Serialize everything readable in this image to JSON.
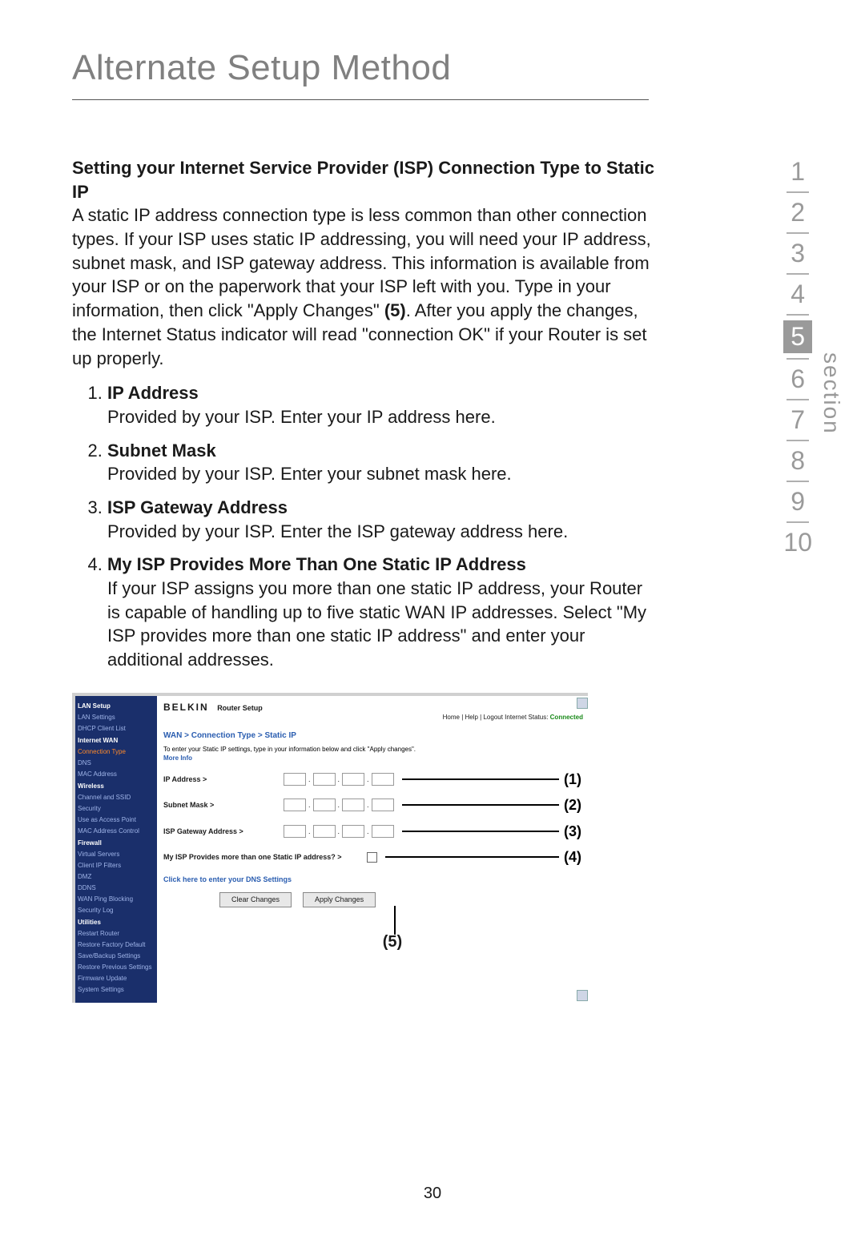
{
  "page_number": "30",
  "title": "Alternate Setup Method",
  "section_label": "section",
  "nav": {
    "items": [
      "1",
      "2",
      "3",
      "4",
      "5",
      "6",
      "7",
      "8",
      "9",
      "10"
    ],
    "current": "5"
  },
  "intro": {
    "heading": "Setting your Internet Service Provider (ISP) Connection Type to Static IP",
    "body_a": "A static IP address connection type is less common than other connection types. If your ISP uses static IP addressing, you will need your IP address, subnet mask, and ISP gateway address. This information is available from your ISP or on the paperwork that your ISP left with you. Type in your information, then click \"Apply Changes\" ",
    "body_bold": "(5)",
    "body_b": ". After you apply the changes, the Internet Status indicator will read \"connection OK\" if your Router is set up properly."
  },
  "fields": [
    {
      "h": "IP Address",
      "d": "Provided by your ISP. Enter your IP address here."
    },
    {
      "h": "Subnet Mask",
      "d": "Provided by your ISP. Enter your subnet mask here."
    },
    {
      "h": "ISP Gateway Address",
      "d": "Provided by your ISP. Enter the ISP gateway address here."
    },
    {
      "h": "My ISP Provides More Than One Static IP Address",
      "d": "If your ISP assigns you more than one static IP address, your Router is capable of handling up to five static WAN IP addresses. Select \"My ISP provides more than one static IP address\" and enter your additional addresses."
    }
  ],
  "fig": {
    "brand": "BELKIN",
    "subtitle": "Router Setup",
    "toplinks": "Home | Help | Logout   Internet Status: ",
    "status_ok": "Connected",
    "crumb": "WAN > Connection Type > Static IP",
    "instr": "To enter your Static IP settings, type in your information below and click \"Apply changes\".",
    "more_info": "More Info",
    "rows": [
      {
        "lbl": "IP Address >",
        "callout": "(1)"
      },
      {
        "lbl": "Subnet Mask >",
        "callout": "(2)"
      },
      {
        "lbl": "ISP Gateway Address >",
        "callout": "(3)"
      }
    ],
    "multi_lbl": "My ISP Provides more than one Static IP address? >",
    "multi_callout": "(4)",
    "dns_link": "Click here to enter your DNS Settings",
    "btn_clear": "Clear Changes",
    "btn_apply": "Apply Changes",
    "five": "(5)",
    "sidebar": [
      {
        "t": "LAN Setup",
        "g": true
      },
      {
        "t": "LAN Settings"
      },
      {
        "t": "DHCP Client List"
      },
      {
        "t": "Internet WAN",
        "g": true
      },
      {
        "t": "Connection Type",
        "sel": true
      },
      {
        "t": "DNS"
      },
      {
        "t": "MAC Address"
      },
      {
        "t": "Wireless",
        "g": true
      },
      {
        "t": "Channel and SSID"
      },
      {
        "t": "Security"
      },
      {
        "t": "Use as Access Point"
      },
      {
        "t": "MAC Address Control"
      },
      {
        "t": "Firewall",
        "g": true
      },
      {
        "t": "Virtual Servers"
      },
      {
        "t": "Client IP Filters"
      },
      {
        "t": "DMZ"
      },
      {
        "t": "DDNS"
      },
      {
        "t": "WAN Ping Blocking"
      },
      {
        "t": "Security Log"
      },
      {
        "t": "Utilities",
        "g": true
      },
      {
        "t": "Restart Router"
      },
      {
        "t": "Restore Factory Default"
      },
      {
        "t": "Save/Backup Settings"
      },
      {
        "t": "Restore Previous Settings"
      },
      {
        "t": "Firmware Update"
      },
      {
        "t": "System Settings"
      }
    ]
  }
}
